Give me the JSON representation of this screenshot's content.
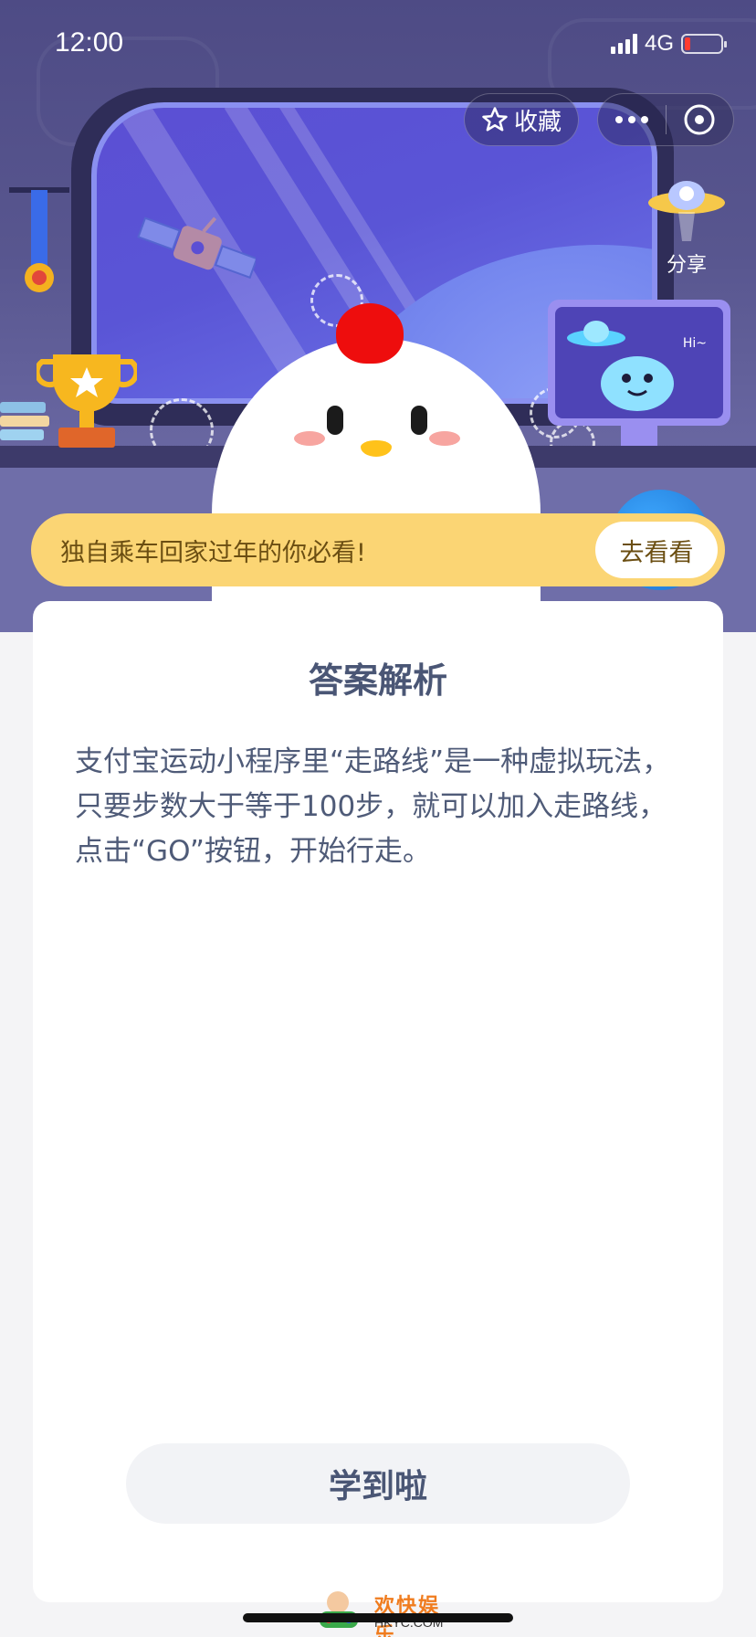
{
  "status_bar": {
    "time": "12:00",
    "network": "4G",
    "battery_level": 0.15
  },
  "header": {
    "favorite_label": "收藏",
    "share_label": "分享",
    "monitor_text": "Hi~"
  },
  "banner": {
    "text": "独自乘车回家过年的你必看!",
    "button_label": "去看看"
  },
  "card": {
    "title": "答案解析",
    "body": "支付宝运动小程序里“走路线”是一种虚拟玩法，只要步数大于等于100步，就可以加入走路线，点击“GO”按钮，开始行走。",
    "button_label": "学到啦"
  },
  "watermark": {
    "text": "欢快娱乐",
    "sub": "HKYC.COM"
  },
  "colors": {
    "header_bg": "#58568f",
    "banner_bg": "#fbd574",
    "banner_text": "#6b4e12",
    "card_text": "#4a5675",
    "accent_red": "#ee0d0d"
  },
  "icons": [
    "star-icon",
    "more-icon",
    "close-mini-program-icon",
    "ufo-share-icon",
    "trophy-icon",
    "medal-icon",
    "satellite-icon"
  ]
}
